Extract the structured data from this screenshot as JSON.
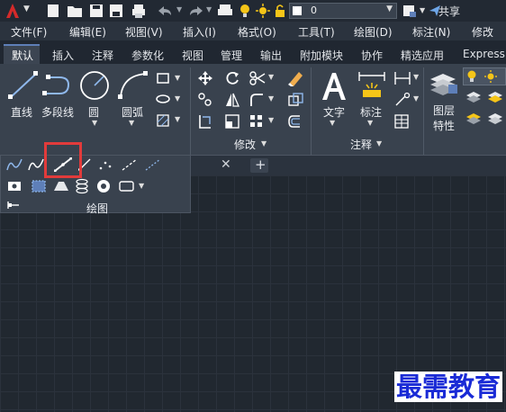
{
  "quick_access": {
    "layer_value": "0",
    "share_label": "共享"
  },
  "menubar": {
    "items": [
      "文件(F)",
      "编辑(E)",
      "视图(V)",
      "插入(I)",
      "格式(O)",
      "工具(T)",
      "绘图(D)",
      "标注(N)",
      "修改(M)"
    ]
  },
  "ribbon_tabs": {
    "items": [
      "默认",
      "插入",
      "注释",
      "参数化",
      "视图",
      "管理",
      "输出",
      "附加模块",
      "协作",
      "精选应用",
      "Express"
    ],
    "active": "默认"
  },
  "draw_panel": {
    "line_label": "直线",
    "polyline_label": "多段线",
    "circle_label": "圆",
    "arc_label": "圆弧",
    "title": "绘图"
  },
  "modify_panel": {
    "title": "修改"
  },
  "annotation_panel": {
    "text_label": "文字",
    "dim_label": "标注",
    "title": "注释"
  },
  "layers_panel": {
    "layer_props_label_line1": "图层",
    "layer_props_label_line2": "特性"
  },
  "watermark": "最需教育",
  "colors": {
    "accent": "#5e7fb8",
    "highlight": "#e23b3b",
    "bulb": "#f5c518"
  }
}
